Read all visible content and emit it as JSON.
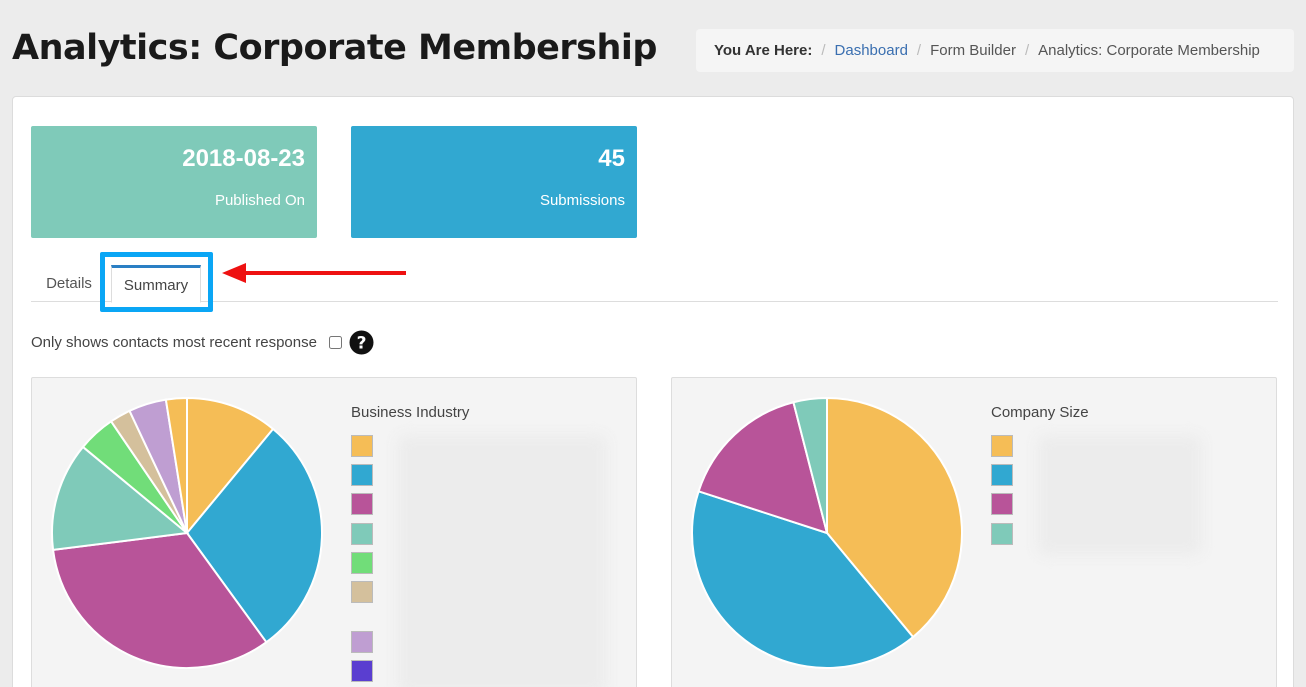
{
  "header": {
    "title": "Analytics: Corporate Membership"
  },
  "breadcrumb": {
    "label": "You Are Here:",
    "items": [
      {
        "text": "Dashboard",
        "link": true
      },
      {
        "text": "Form Builder",
        "link": false
      },
      {
        "text": "Analytics: Corporate Membership",
        "link": false
      }
    ]
  },
  "stats": {
    "published": {
      "value": "2018-08-23",
      "label": "Published On",
      "color": "#7fcab9"
    },
    "submissions": {
      "value": "45",
      "label": "Submissions",
      "color": "#31a8d1"
    }
  },
  "tabs": {
    "details": "Details",
    "summary": "Summary",
    "active": "summary"
  },
  "filter": {
    "label": "Only shows contacts most recent response",
    "checked": false,
    "icon": "question-circle-icon"
  },
  "chart_data": [
    {
      "type": "pie",
      "title": "Business Industry",
      "values": [
        11,
        29,
        33,
        13,
        4.5,
        2.5,
        4.5,
        2.5
      ],
      "colors": [
        "#f5bd56",
        "#31a8d1",
        "#b85499",
        "#7fcab9",
        "#71dd79",
        "#d4c09c",
        "#bf9ed2",
        "#f5bd56"
      ],
      "legend_swatches": [
        "#f5bd56",
        "#31a8d1",
        "#b85499",
        "#7fcab9",
        "#71dd79",
        "#d4c09c",
        "#bf9ed2",
        "#5a3ed0"
      ],
      "legend_labels_visible": false
    },
    {
      "type": "pie",
      "title": "Company Size",
      "values": [
        39,
        41,
        16,
        4
      ],
      "colors": [
        "#f5bd56",
        "#31a8d1",
        "#b85499",
        "#7fcab9"
      ],
      "legend_swatches": [
        "#f5bd56",
        "#31a8d1",
        "#b85499",
        "#7fcab9"
      ],
      "legend_labels_visible": false
    }
  ]
}
